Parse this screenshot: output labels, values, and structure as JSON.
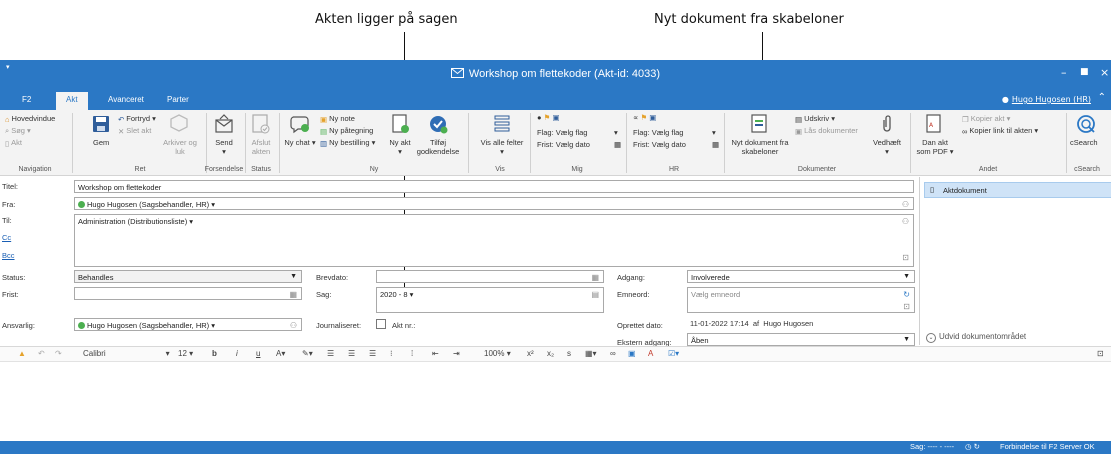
{
  "callouts": {
    "left": "Akten ligger på sagen",
    "right": "Nyt dokument fra skabeloner"
  },
  "window": {
    "title": "Workshop om flettekoder (Akt-id: 4033)"
  },
  "tabs": [
    "F2",
    "Akt",
    "Avanceret",
    "Parter"
  ],
  "user": "Hugo Hugosen (HR)",
  "ribbon": {
    "navigation": {
      "items": [
        "Hovedvindue",
        "Søg",
        "Akt"
      ],
      "label": "Navigation"
    },
    "ret": {
      "gem": "Gem",
      "fortryd": "Fortryd",
      "slet": "Slet akt",
      "arkiver": "Arkiver og luk",
      "label": "Ret"
    },
    "forsendelse": {
      "send": "Send",
      "label": "Forsendelse"
    },
    "status": {
      "afslut": "Afslut akten",
      "label": "Status"
    },
    "ny": {
      "chat": "Ny chat",
      "note": "Ny note",
      "paategning": "Ny påtegning",
      "bestilling": "Ny bestilling",
      "akt": "Ny akt",
      "godkendelse": "Tilføj godkendelse",
      "label": "Ny"
    },
    "vis": {
      "alle_felter": "Vis alle felter",
      "label": "Vis"
    },
    "mig": {
      "flag": "Flag:",
      "flag_val": "Vælg flag",
      "frist": "Frist:",
      "frist_val": "Vælg dato",
      "label": "Mig"
    },
    "hr": {
      "flag": "Flag:",
      "flag_val": "Vælg flag",
      "frist": "Frist:",
      "frist_val": "Vælg dato",
      "label": "HR"
    },
    "dokumenter": {
      "nyt": "Nyt dokument fra skabeloner",
      "udskriv": "Udskriv",
      "laas": "Lås dokumenter",
      "vedhaeft": "Vedhæft",
      "label": "Dokumenter"
    },
    "andet": {
      "pdf": "Dan akt som PDF",
      "kopier_akt": "Kopier akt",
      "kopier_link": "Kopier link til akten",
      "label": "Andet"
    },
    "csearch": {
      "btn": "cSearch",
      "label": "cSearch"
    }
  },
  "form": {
    "titel_label": "Titel:",
    "titel": "Workshop om flettekoder",
    "fra_label": "Fra:",
    "fra": "Hugo Hugosen (Sagsbehandler, HR)",
    "til_label": "Til:",
    "til": "Administration (Distributionsliste)",
    "cc_label": "Cc",
    "bcc_label": "Bcc",
    "status_label": "Status:",
    "status": "Behandles",
    "frist_label": "Frist:",
    "frist": "",
    "ansvarlig_label": "Ansvarlig:",
    "ansvarlig": "Hugo Hugosen (Sagsbehandler, HR)",
    "brevdato_label": "Brevdato:",
    "brevdato": "",
    "sag_label": "Sag:",
    "sag": "2020 - 8",
    "journaliseret_label": "Journaliseret:",
    "aktnr_label": "Akt nr.:",
    "adgang_label": "Adgang:",
    "adgang": "Involverede",
    "emneord_label": "Emneord:",
    "emneord_placeholder": "Vælg emneord",
    "oprettet_label": "Oprettet dato:",
    "oprettet": "11-01-2022 17:14",
    "af": "af",
    "oprettet_af": "Hugo Hugosen",
    "ekstern_label": "Ekstern adgang:",
    "ekstern": "Åben"
  },
  "sidepanel": {
    "aktdokument": "Aktdokument",
    "udvid": "Udvid dokumentområdet"
  },
  "editor": {
    "font": "Calibri",
    "size": "12",
    "zoom": "100%"
  },
  "statusbar": {
    "sag": "Sag: ---- - ----",
    "forbindelse": "Forbindelse til F2 Server OK"
  }
}
